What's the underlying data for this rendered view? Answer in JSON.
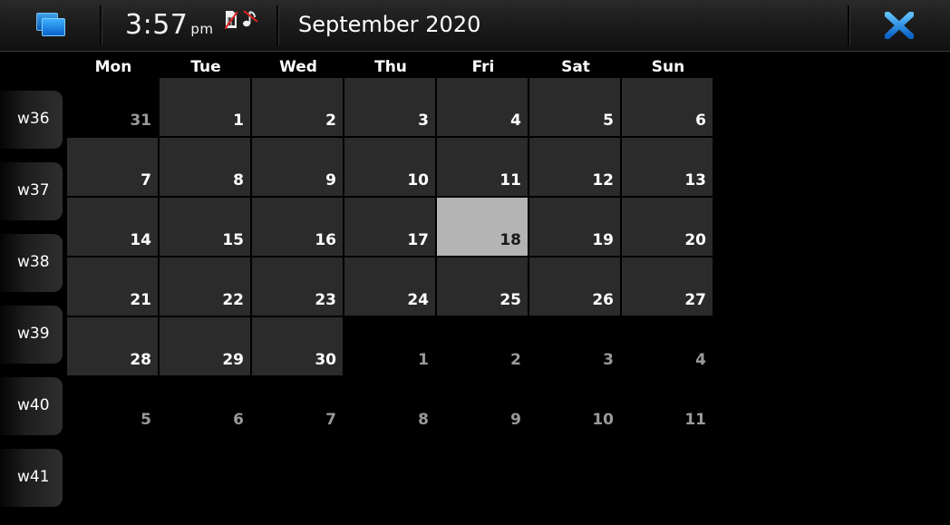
{
  "topbar": {
    "switcher_icon": "task-switcher-icon",
    "clock_time": "3:57",
    "clock_ampm": "pm",
    "status_icons": [
      "no-sim-icon",
      "music-muted-icon"
    ],
    "title": "September 2020",
    "close_icon": "close-icon",
    "accent_color": "#1c86e6"
  },
  "calendar": {
    "day_headers": [
      "Mon",
      "Tue",
      "Wed",
      "Thu",
      "Fri",
      "Sat",
      "Sun"
    ],
    "weeks": [
      {
        "label": "w36",
        "days": [
          {
            "n": "31",
            "month": "prev"
          },
          {
            "n": "1",
            "month": "cur"
          },
          {
            "n": "2",
            "month": "cur"
          },
          {
            "n": "3",
            "month": "cur"
          },
          {
            "n": "4",
            "month": "cur"
          },
          {
            "n": "5",
            "month": "cur"
          },
          {
            "n": "6",
            "month": "cur"
          }
        ]
      },
      {
        "label": "w37",
        "days": [
          {
            "n": "7",
            "month": "cur"
          },
          {
            "n": "8",
            "month": "cur"
          },
          {
            "n": "9",
            "month": "cur"
          },
          {
            "n": "10",
            "month": "cur"
          },
          {
            "n": "11",
            "month": "cur"
          },
          {
            "n": "12",
            "month": "cur"
          },
          {
            "n": "13",
            "month": "cur"
          }
        ]
      },
      {
        "label": "w38",
        "days": [
          {
            "n": "14",
            "month": "cur"
          },
          {
            "n": "15",
            "month": "cur"
          },
          {
            "n": "16",
            "month": "cur"
          },
          {
            "n": "17",
            "month": "cur"
          },
          {
            "n": "18",
            "month": "cur",
            "today": true
          },
          {
            "n": "19",
            "month": "cur"
          },
          {
            "n": "20",
            "month": "cur"
          }
        ]
      },
      {
        "label": "w39",
        "days": [
          {
            "n": "21",
            "month": "cur"
          },
          {
            "n": "22",
            "month": "cur"
          },
          {
            "n": "23",
            "month": "cur"
          },
          {
            "n": "24",
            "month": "cur"
          },
          {
            "n": "25",
            "month": "cur"
          },
          {
            "n": "26",
            "month": "cur"
          },
          {
            "n": "27",
            "month": "cur"
          }
        ]
      },
      {
        "label": "w40",
        "days": [
          {
            "n": "28",
            "month": "cur"
          },
          {
            "n": "29",
            "month": "cur"
          },
          {
            "n": "30",
            "month": "cur"
          },
          {
            "n": "1",
            "month": "next"
          },
          {
            "n": "2",
            "month": "next"
          },
          {
            "n": "3",
            "month": "next"
          },
          {
            "n": "4",
            "month": "next"
          }
        ]
      },
      {
        "label": "w41",
        "days": [
          {
            "n": "5",
            "month": "next"
          },
          {
            "n": "6",
            "month": "next"
          },
          {
            "n": "7",
            "month": "next"
          },
          {
            "n": "8",
            "month": "next"
          },
          {
            "n": "9",
            "month": "next"
          },
          {
            "n": "10",
            "month": "next"
          },
          {
            "n": "11",
            "month": "next"
          }
        ]
      }
    ],
    "colors": {
      "cell": "#2b2b2b",
      "today": "#b4b4b4",
      "other_month_text": "#9a9a9a"
    }
  }
}
